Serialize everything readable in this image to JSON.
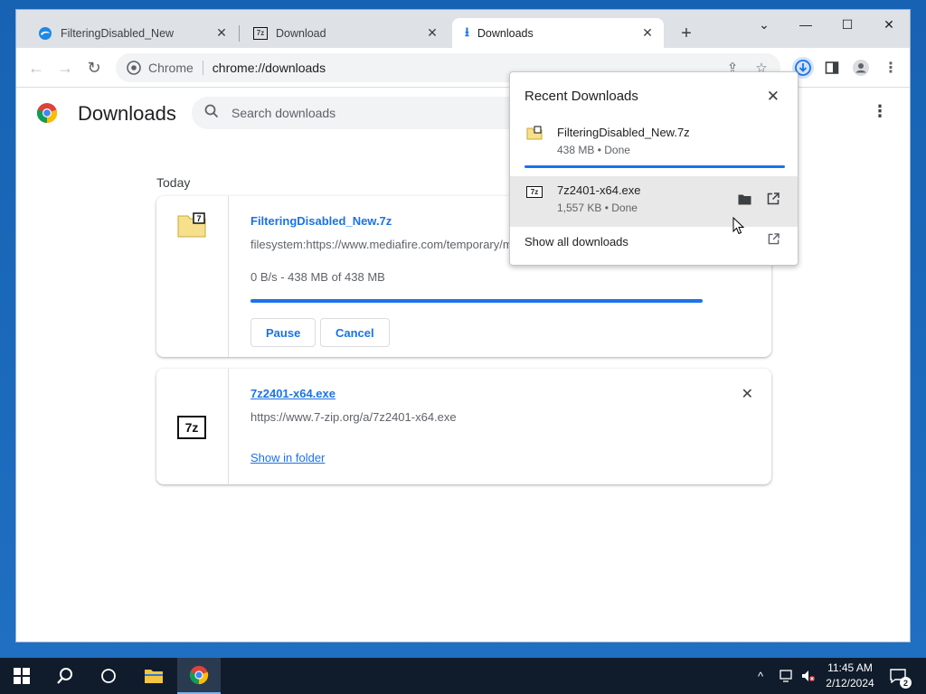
{
  "tabs": [
    {
      "title": "FilteringDisabled_New",
      "icon": "edge-icon",
      "active": false
    },
    {
      "title": "Download",
      "icon": "sevenzip-icon",
      "active": false
    },
    {
      "title": "Downloads",
      "icon": "download-icon",
      "active": true
    }
  ],
  "omnibox": {
    "site_label": "Chrome",
    "url": "chrome://downloads"
  },
  "page": {
    "title": "Downloads",
    "search_placeholder": "Search downloads",
    "date_label": "Today"
  },
  "downloads": [
    {
      "name": "FilteringDisabled_New.7z",
      "url": "filesystem:https://www.mediafire.com/temporary/mfo",
      "status": "0 B/s - 438 MB of 438 MB",
      "progress": 1.0,
      "pause_label": "Pause",
      "cancel_label": "Cancel"
    },
    {
      "name": "7z2401-x64.exe",
      "url": "https://www.7-zip.org/a/7z2401-x64.exe",
      "action_label": "Show in folder"
    }
  ],
  "bubble": {
    "title": "Recent Downloads",
    "items": [
      {
        "name": "FilteringDisabled_New.7z",
        "status": "438 MB • Done",
        "progress": 1.0
      },
      {
        "name": "7z2401-x64.exe",
        "status": "1,557 KB • Done"
      }
    ],
    "footer": "Show all downloads"
  },
  "taskbar": {
    "time": "11:45 AM",
    "date": "2/12/2024",
    "notification_count": "2"
  },
  "colors": {
    "accent": "#1a73e8",
    "taskbar": "#101c2c",
    "desktop": "#1b5ea8"
  }
}
